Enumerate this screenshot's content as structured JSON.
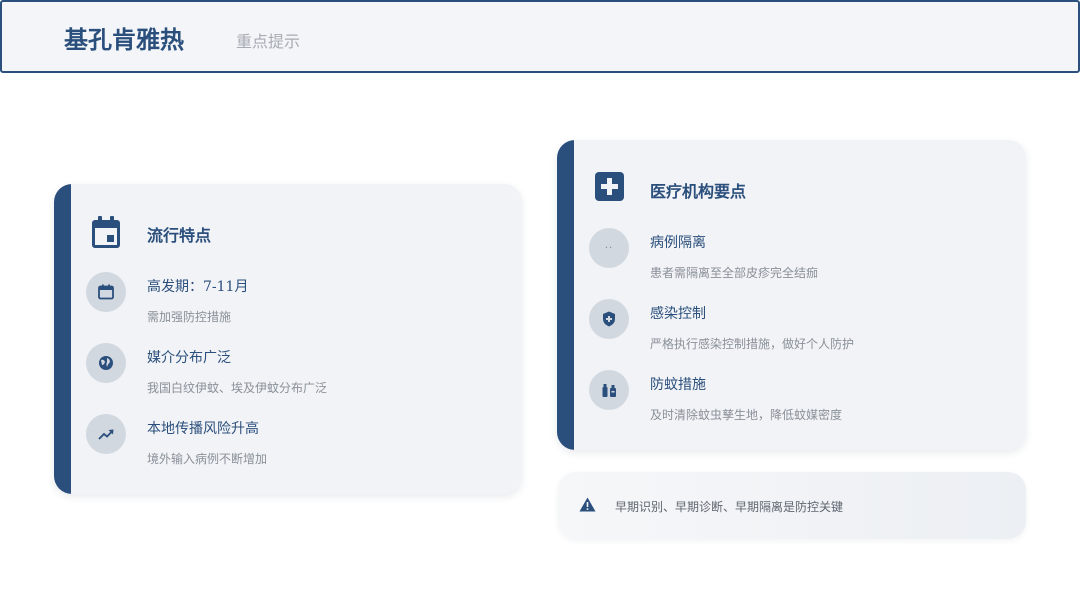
{
  "header": {
    "title": "基孔肯雅热",
    "subtitle": "重点提示"
  },
  "left_card": {
    "title": "流行特点",
    "icon": "calendar-icon",
    "items": [
      {
        "icon": "calendar-small-icon",
        "title": "高发期：7-11月",
        "desc": "需加强防控措施"
      },
      {
        "icon": "globe-icon",
        "title": "媒介分布广泛",
        "desc": "我国白纹伊蚊、埃及伊蚊分布广泛"
      },
      {
        "icon": "trending-up-icon",
        "title": "本地传播风险升高",
        "desc": "境外输入病例不断增加"
      }
    ]
  },
  "right_card": {
    "title": "医疗机构要点",
    "icon": "medical-cross-icon",
    "items": [
      {
        "icon": "dots-icon",
        "glyph": "··",
        "title": "病例隔离",
        "desc": "患者需隔离至全部皮疹完全结痂"
      },
      {
        "icon": "shield-icon",
        "title": "感染控制",
        "desc": "严格执行感染控制措施，做好个人防护"
      },
      {
        "icon": "spray-icon",
        "title": "防蚊措施",
        "desc": "及时清除蚊虫孳生地，降低蚊媒密度"
      }
    ]
  },
  "notice": {
    "icon": "warning-icon",
    "text": "早期识别、早期诊断、早期隔离是防控关键"
  },
  "colors": {
    "primary": "#2b4f7c",
    "card_bg": "#f1f3f6",
    "circle_bg": "#d2d8e0",
    "muted_text": "#8a9099"
  }
}
